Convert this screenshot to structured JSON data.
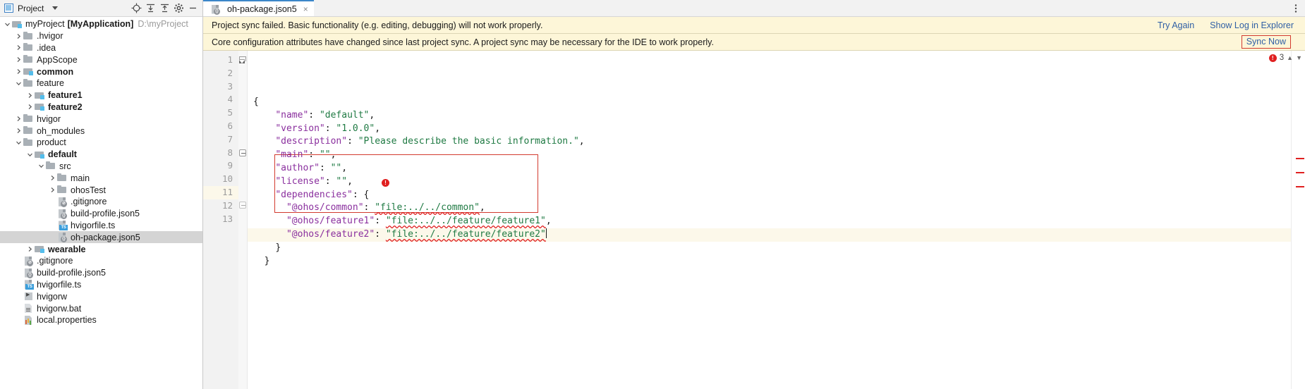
{
  "sidebar": {
    "panel_title": "Project",
    "toolbar_icons": [
      "locate-target-icon",
      "expand-all-icon",
      "collapse-all-icon",
      "settings-gear-icon",
      "minimize-icon"
    ],
    "tree": [
      {
        "indent": 0,
        "arrow": "down",
        "icon": "project-folder-icon",
        "label": "myProject",
        "bold_label": "[MyApplication]",
        "path": "D:\\myProject",
        "selected": false
      },
      {
        "indent": 1,
        "arrow": "right",
        "icon": "folder-icon",
        "label": ".hvigor",
        "selected": false
      },
      {
        "indent": 1,
        "arrow": "right",
        "icon": "folder-icon",
        "label": ".idea",
        "selected": false
      },
      {
        "indent": 1,
        "arrow": "right",
        "icon": "folder-icon",
        "label": "AppScope",
        "selected": false
      },
      {
        "indent": 1,
        "arrow": "right",
        "icon": "module-folder-icon",
        "label": "common",
        "bold": true,
        "selected": false
      },
      {
        "indent": 1,
        "arrow": "down",
        "icon": "folder-icon",
        "label": "feature",
        "selected": false
      },
      {
        "indent": 2,
        "arrow": "right",
        "icon": "module-folder-icon",
        "label": "feature1",
        "bold": true,
        "selected": false
      },
      {
        "indent": 2,
        "arrow": "right",
        "icon": "module-folder-icon",
        "label": "feature2",
        "bold": true,
        "selected": false
      },
      {
        "indent": 1,
        "arrow": "right",
        "icon": "folder-icon",
        "label": "hvigor",
        "selected": false
      },
      {
        "indent": 1,
        "arrow": "right",
        "icon": "folder-icon",
        "label": "oh_modules",
        "selected": false
      },
      {
        "indent": 1,
        "arrow": "down",
        "icon": "folder-icon",
        "label": "product",
        "selected": false
      },
      {
        "indent": 2,
        "arrow": "down",
        "icon": "module-folder-icon",
        "label": "default",
        "bold": true,
        "selected": false
      },
      {
        "indent": 3,
        "arrow": "down",
        "icon": "folder-icon",
        "label": "src",
        "selected": false
      },
      {
        "indent": 4,
        "arrow": "right",
        "icon": "folder-icon",
        "label": "main",
        "selected": false
      },
      {
        "indent": 4,
        "arrow": "right",
        "icon": "folder-icon",
        "label": "ohosTest",
        "selected": false
      },
      {
        "indent": 4,
        "arrow": "none",
        "icon": "gitignore-file-icon",
        "label": ".gitignore",
        "selected": false
      },
      {
        "indent": 4,
        "arrow": "none",
        "icon": "json5-file-icon",
        "label": "build-profile.json5",
        "selected": false
      },
      {
        "indent": 4,
        "arrow": "none",
        "icon": "ts-file-icon",
        "label": "hvigorfile.ts",
        "selected": false
      },
      {
        "indent": 4,
        "arrow": "none",
        "icon": "json5-file-icon",
        "label": "oh-package.json5",
        "selected": true
      },
      {
        "indent": 2,
        "arrow": "right",
        "icon": "module-folder-icon",
        "label": "wearable",
        "bold": true,
        "selected": false
      },
      {
        "indent": 1,
        "arrow": "none",
        "icon": "gitignore-file-icon",
        "label": ".gitignore",
        "selected": false
      },
      {
        "indent": 1,
        "arrow": "none",
        "icon": "json5-file-icon",
        "label": "build-profile.json5",
        "selected": false
      },
      {
        "indent": 1,
        "arrow": "none",
        "icon": "ts-file-icon",
        "label": "hvigorfile.ts",
        "selected": false
      },
      {
        "indent": 1,
        "arrow": "none",
        "icon": "executable-file-icon",
        "label": "hvigorw",
        "selected": false
      },
      {
        "indent": 1,
        "arrow": "none",
        "icon": "bat-file-icon",
        "label": "hvigorw.bat",
        "selected": false
      },
      {
        "indent": 1,
        "arrow": "none",
        "icon": "properties-file-icon",
        "label": "local.properties",
        "selected": false
      }
    ]
  },
  "tabs": [
    {
      "label": "oh-package.json5",
      "icon": "json5-file-icon",
      "active": true,
      "close": "×"
    }
  ],
  "banners": [
    {
      "message": "Project sync failed. Basic functionality (e.g. editing, debugging) will not work properly.",
      "actions": [
        "Try Again",
        "Show Log in Explorer"
      ],
      "highlighted_action": null
    },
    {
      "message": "Core configuration attributes have changed since last project sync. A project sync may be necessary for the IDE to work properly.",
      "actions": [
        "Sync Now"
      ],
      "highlighted_action": "Sync Now"
    }
  ],
  "editor": {
    "filename": "oh-package.json5",
    "error_count": "3",
    "error_badge_glyph": "!",
    "lines": [
      {
        "n": "1",
        "html": "<span class='tok-punc'>{</span>",
        "fold": "tri",
        "highlight": false
      },
      {
        "n": "2",
        "html": "    <span class='tok-key'>\"name\"</span><span class='tok-punc'>: </span><span class='tok-str'>\"default\"</span><span class='tok-punc'>,</span>",
        "highlight": false
      },
      {
        "n": "3",
        "html": "    <span class='tok-key'>\"version\"</span><span class='tok-punc'>: </span><span class='tok-str'>\"1.0.0\"</span><span class='tok-punc'>,</span>",
        "highlight": false
      },
      {
        "n": "4",
        "html": "    <span class='tok-key'>\"description\"</span><span class='tok-punc'>: </span><span class='tok-str'>\"Please describe the basic information.\"</span><span class='tok-punc'>,</span>",
        "highlight": false
      },
      {
        "n": "5",
        "html": "    <span class='tok-key'>\"main\"</span><span class='tok-punc'>: </span><span class='tok-str'>\"\"</span><span class='tok-punc'>,</span>",
        "highlight": false
      },
      {
        "n": "6",
        "html": "    <span class='tok-key'>\"author\"</span><span class='tok-punc'>: </span><span class='tok-str'>\"\"</span><span class='tok-punc'>,</span>",
        "highlight": false
      },
      {
        "n": "7",
        "html": "    <span class='tok-key'>\"license\"</span><span class='tok-punc'>: </span><span class='tok-str'>\"\"</span><span class='tok-punc'>,</span>",
        "highlight": false
      },
      {
        "n": "8",
        "html": "    <span class='tok-key'>\"dependencies\"</span><span class='tok-punc'>: {</span>",
        "fold": "minus",
        "highlight": false
      },
      {
        "n": "9",
        "html": "      <span class='tok-key'>\"@ohos/common\"</span><span class='tok-punc'>: </span><span class='tok-str squig'>\"file:../../common\"</span><span class='tok-punc'>,</span>",
        "highlight": false
      },
      {
        "n": "10",
        "html": "      <span class='tok-key'>\"@ohos/feature1\"</span><span class='tok-punc'>: </span><span class='tok-str squig'>\"file:../../feature/feature1\"</span><span class='tok-punc'>,</span>",
        "highlight": false
      },
      {
        "n": "11",
        "html": "      <span class='tok-key'>\"@ohos/feature2\"</span><span class='tok-punc'>: </span><span class='tok-str squig'>\"file:../../feature/feature2\"</span><span class='caret'></span>",
        "highlight": true
      },
      {
        "n": "12",
        "html": "    <span class='tok-punc'>}</span>",
        "fold": "minus-small",
        "highlight": false
      },
      {
        "n": "13",
        "html": "  <span class='tok-punc'>}</span>",
        "highlight": false
      }
    ]
  }
}
